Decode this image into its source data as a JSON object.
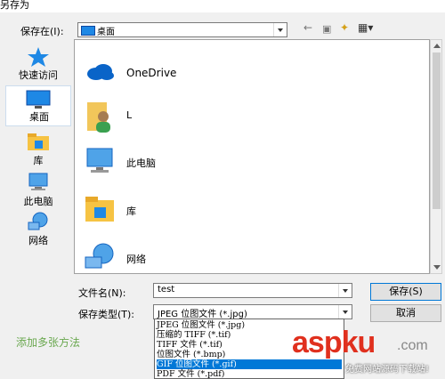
{
  "window": {
    "title": "另存为"
  },
  "save_in": {
    "label": "保存在(I):",
    "value": "桌面"
  },
  "toolbar": {
    "back": "←",
    "up": "▣",
    "newfolder": "✦",
    "view": "▦▾"
  },
  "places": [
    {
      "label": "快速访问",
      "icon": "star-icon"
    },
    {
      "label": "桌面",
      "icon": "desktop-icon",
      "selected": true
    },
    {
      "label": "库",
      "icon": "library-icon"
    },
    {
      "label": "此电脑",
      "icon": "computer-icon"
    },
    {
      "label": "网络",
      "icon": "network-icon"
    }
  ],
  "files": [
    {
      "name": "OneDrive",
      "icon": "cloud-icon"
    },
    {
      "name": "L",
      "icon": "user-folder-icon"
    },
    {
      "name": "此电脑",
      "icon": "computer-icon"
    },
    {
      "name": "库",
      "icon": "library-icon"
    },
    {
      "name": "网络",
      "icon": "network-icon"
    }
  ],
  "filename": {
    "label": "文件名(N):",
    "value": "test"
  },
  "filetype": {
    "label": "保存类型(T):",
    "value": "JPEG 位图文件 (*.jpg)",
    "options": [
      "JPEG 位图文件 (*.jpg)",
      "压缩的 TIFF (*.tif)",
      "TIFF 文件 (*.tif)",
      "位图文件 (*.bmp)",
      "GIF 位图文件 (*.gif)",
      "PDF 文件 (*.pdf)"
    ],
    "selected_index": 4
  },
  "buttons": {
    "save": "保存(S)",
    "cancel": "取消"
  },
  "watermark": {
    "brand": "aspku",
    "suffix": ".com",
    "tagline": "免费网站源码下载站!"
  },
  "background_text": "添加多张方法",
  "colors": {
    "accent": "#0078d7",
    "brand_red": "#e0301e",
    "desktop_blue": "#1e88e5"
  }
}
